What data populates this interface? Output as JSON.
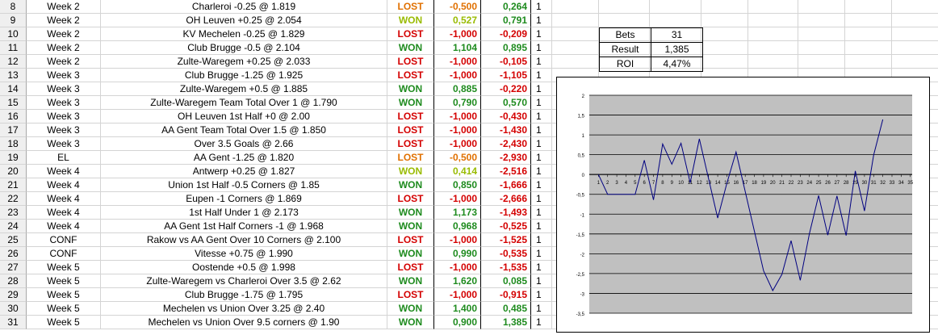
{
  "rows": [
    {
      "num": "8",
      "week": "Week 2",
      "bet": "Charleroi -0.25 @ 1.819",
      "result": "LOST",
      "rcolor": "orange",
      "units": "-0,500",
      "cum": "0,264",
      "ccolor": "green",
      "stake": "1"
    },
    {
      "num": "9",
      "week": "Week 2",
      "bet": "OH Leuven +0.25 @ 2.054",
      "result": "WON",
      "rcolor": "lime",
      "units": "0,527",
      "cum": "0,791",
      "ccolor": "green",
      "stake": "1"
    },
    {
      "num": "10",
      "week": "Week 2",
      "bet": "KV Mechelen -0.25 @ 1.829",
      "result": "LOST",
      "rcolor": "red",
      "units": "-1,000",
      "cum": "-0,209",
      "ccolor": "red",
      "stake": "1"
    },
    {
      "num": "11",
      "week": "Week 2",
      "bet": "Club Brugge -0.5 @ 2.104",
      "result": "WON",
      "rcolor": "green",
      "units": "1,104",
      "cum": "0,895",
      "ccolor": "green",
      "stake": "1"
    },
    {
      "num": "12",
      "week": "Week 2",
      "bet": "Zulte-Waregem +0.25 @ 2.033",
      "result": "LOST",
      "rcolor": "red",
      "units": "-1,000",
      "cum": "-0,105",
      "ccolor": "red",
      "stake": "1"
    },
    {
      "num": "13",
      "week": "Week 3",
      "bet": "Club Brugge -1.25 @ 1.925",
      "result": "LOST",
      "rcolor": "red",
      "units": "-1,000",
      "cum": "-1,105",
      "ccolor": "red",
      "stake": "1"
    },
    {
      "num": "14",
      "week": "Week 3",
      "bet": "Zulte-Waregem +0.5 @ 1.885",
      "result": "WON",
      "rcolor": "green",
      "units": "0,885",
      "cum": "-0,220",
      "ccolor": "red",
      "stake": "1"
    },
    {
      "num": "15",
      "week": "Week 3",
      "bet": "Zulte-Waregem Team Total Over 1 @ 1.790",
      "result": "WON",
      "rcolor": "green",
      "units": "0,790",
      "cum": "0,570",
      "ccolor": "green",
      "stake": "1"
    },
    {
      "num": "16",
      "week": "Week 3",
      "bet": "OH Leuven 1st Half +0 @ 2.00",
      "result": "LOST",
      "rcolor": "red",
      "units": "-1,000",
      "cum": "-0,430",
      "ccolor": "red",
      "stake": "1"
    },
    {
      "num": "17",
      "week": "Week 3",
      "bet": "AA Gent Team Total Over 1.5 @ 1.850",
      "result": "LOST",
      "rcolor": "red",
      "units": "-1,000",
      "cum": "-1,430",
      "ccolor": "red",
      "stake": "1"
    },
    {
      "num": "18",
      "week": "Week 3",
      "bet": "Over 3.5 Goals @ 2.66",
      "result": "LOST",
      "rcolor": "red",
      "units": "-1,000",
      "cum": "-2,430",
      "ccolor": "red",
      "stake": "1"
    },
    {
      "num": "19",
      "week": "EL",
      "bet": "AA Gent -1.25 @ 1.820",
      "result": "LOST",
      "rcolor": "orange",
      "units": "-0,500",
      "cum": "-2,930",
      "ccolor": "red",
      "stake": "1"
    },
    {
      "num": "20",
      "week": "Week 4",
      "bet": "Antwerp +0.25 @ 1.827",
      "result": "WON",
      "rcolor": "lime",
      "units": "0,414",
      "cum": "-2,516",
      "ccolor": "red",
      "stake": "1"
    },
    {
      "num": "21",
      "week": "Week 4",
      "bet": "Union 1st Half -0.5 Corners @ 1.85",
      "result": "WON",
      "rcolor": "green",
      "units": "0,850",
      "cum": "-1,666",
      "ccolor": "red",
      "stake": "1"
    },
    {
      "num": "22",
      "week": "Week 4",
      "bet": "Eupen -1 Corners @ 1.869",
      "result": "LOST",
      "rcolor": "red",
      "units": "-1,000",
      "cum": "-2,666",
      "ccolor": "red",
      "stake": "1"
    },
    {
      "num": "23",
      "week": "Week 4",
      "bet": "1st Half Under 1 @ 2.173",
      "result": "WON",
      "rcolor": "green",
      "units": "1,173",
      "cum": "-1,493",
      "ccolor": "red",
      "stake": "1"
    },
    {
      "num": "24",
      "week": "Week 4",
      "bet": "AA Gent 1st Half Corners -1 @ 1.968",
      "result": "WON",
      "rcolor": "green",
      "units": "0,968",
      "cum": "-0,525",
      "ccolor": "red",
      "stake": "1"
    },
    {
      "num": "25",
      "week": "CONF",
      "bet": "Rakow vs AA Gent Over 10 Corners @ 2.100",
      "result": "LOST",
      "rcolor": "red",
      "units": "-1,000",
      "cum": "-1,525",
      "ccolor": "red",
      "stake": "1"
    },
    {
      "num": "26",
      "week": "CONF",
      "bet": "Vitesse +0.75 @ 1.990",
      "result": "WON",
      "rcolor": "green",
      "units": "0,990",
      "cum": "-0,535",
      "ccolor": "red",
      "stake": "1"
    },
    {
      "num": "27",
      "week": "Week 5",
      "bet": "Oostende +0.5 @ 1.998",
      "result": "LOST",
      "rcolor": "red",
      "units": "-1,000",
      "cum": "-1,535",
      "ccolor": "red",
      "stake": "1"
    },
    {
      "num": "28",
      "week": "Week 5",
      "bet": "Zulte-Waregem vs Charleroi Over 3.5 @ 2.62",
      "result": "WON",
      "rcolor": "green",
      "units": "1,620",
      "cum": "0,085",
      "ccolor": "green",
      "stake": "1"
    },
    {
      "num": "29",
      "week": "Week 5",
      "bet": "Club Brugge -1.75 @ 1.795",
      "result": "LOST",
      "rcolor": "red",
      "units": "-1,000",
      "cum": "-0,915",
      "ccolor": "red",
      "stake": "1"
    },
    {
      "num": "30",
      "week": "Week 5",
      "bet": "Mechelen vs Union Over 3.25 @ 2.40",
      "result": "WON",
      "rcolor": "green",
      "units": "1,400",
      "cum": "0,485",
      "ccolor": "green",
      "stake": "1"
    },
    {
      "num": "31",
      "week": "Week 5",
      "bet": "Mechelen vs Union Over 9.5 corners @ 1.90",
      "result": "WON",
      "rcolor": "green",
      "units": "0,900",
      "cum": "1,385",
      "ccolor": "green",
      "stake": "1"
    }
  ],
  "stats": {
    "bets_label": "Bets",
    "bets_value": "31",
    "result_label": "Result",
    "result_value": "1,385",
    "roi_label": "ROI",
    "roi_value": "4,47%"
  },
  "colors": {
    "green": "#1e8b1e",
    "red": "#d40000",
    "orange": "#e07000",
    "lime": "#99bb00",
    "plot_bg": "#c0c0c0",
    "line": "#000080"
  },
  "chart_data": {
    "type": "line",
    "x": [
      1,
      2,
      3,
      4,
      5,
      6,
      7,
      8,
      9,
      10,
      11,
      12,
      13,
      14,
      15,
      16,
      17,
      18,
      19,
      20,
      21,
      22,
      23,
      24,
      25,
      26,
      27,
      28,
      29,
      30,
      31,
      32
    ],
    "series": [
      {
        "values": [
          0,
          -0.5,
          -0.5,
          -0.5,
          -0.5,
          0.36,
          -0.64,
          0.77,
          0.26,
          0.79,
          -0.21,
          0.9,
          -0.1,
          -1.1,
          -0.22,
          0.57,
          -0.43,
          -1.43,
          -2.43,
          -2.93,
          -2.52,
          -1.67,
          -2.67,
          -1.49,
          -0.53,
          -1.53,
          -0.54,
          -1.54,
          0.09,
          -0.92,
          0.49,
          1.39
        ]
      }
    ],
    "xticks": [
      "1",
      "2",
      "3",
      "4",
      "5",
      "6",
      "7",
      "8",
      "9",
      "10",
      "11",
      "12",
      "13",
      "14",
      "15",
      "16",
      "17",
      "18",
      "19",
      "20",
      "21",
      "22",
      "23",
      "24",
      "25",
      "26",
      "27",
      "28",
      "29",
      "30",
      "31",
      "32",
      "33",
      "34",
      "35"
    ],
    "yticks": [
      "2",
      "1,5",
      "1",
      "0,5",
      "0",
      "-0,5",
      "-1",
      "-1,5",
      "-2",
      "-2,5",
      "-3",
      "-3,5"
    ],
    "ylim": [
      -3.5,
      2
    ],
    "grid": true
  }
}
